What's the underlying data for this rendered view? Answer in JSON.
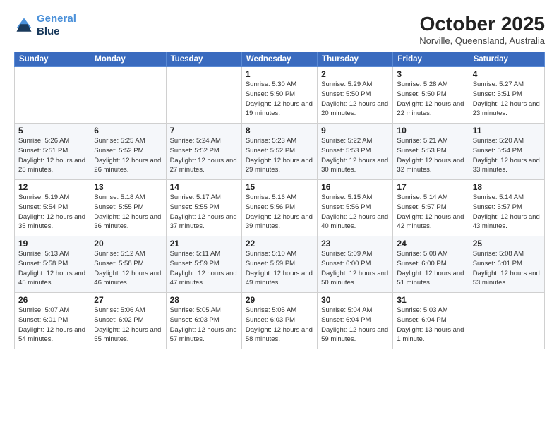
{
  "header": {
    "logo_line1": "General",
    "logo_line2": "Blue",
    "month": "October 2025",
    "location": "Norville, Queensland, Australia"
  },
  "weekdays": [
    "Sunday",
    "Monday",
    "Tuesday",
    "Wednesday",
    "Thursday",
    "Friday",
    "Saturday"
  ],
  "weeks": [
    [
      {
        "day": "",
        "info": ""
      },
      {
        "day": "",
        "info": ""
      },
      {
        "day": "",
        "info": ""
      },
      {
        "day": "1",
        "info": "Sunrise: 5:30 AM\nSunset: 5:50 PM\nDaylight: 12 hours\nand 19 minutes."
      },
      {
        "day": "2",
        "info": "Sunrise: 5:29 AM\nSunset: 5:50 PM\nDaylight: 12 hours\nand 20 minutes."
      },
      {
        "day": "3",
        "info": "Sunrise: 5:28 AM\nSunset: 5:50 PM\nDaylight: 12 hours\nand 22 minutes."
      },
      {
        "day": "4",
        "info": "Sunrise: 5:27 AM\nSunset: 5:51 PM\nDaylight: 12 hours\nand 23 minutes."
      }
    ],
    [
      {
        "day": "5",
        "info": "Sunrise: 5:26 AM\nSunset: 5:51 PM\nDaylight: 12 hours\nand 25 minutes."
      },
      {
        "day": "6",
        "info": "Sunrise: 5:25 AM\nSunset: 5:52 PM\nDaylight: 12 hours\nand 26 minutes."
      },
      {
        "day": "7",
        "info": "Sunrise: 5:24 AM\nSunset: 5:52 PM\nDaylight: 12 hours\nand 27 minutes."
      },
      {
        "day": "8",
        "info": "Sunrise: 5:23 AM\nSunset: 5:52 PM\nDaylight: 12 hours\nand 29 minutes."
      },
      {
        "day": "9",
        "info": "Sunrise: 5:22 AM\nSunset: 5:53 PM\nDaylight: 12 hours\nand 30 minutes."
      },
      {
        "day": "10",
        "info": "Sunrise: 5:21 AM\nSunset: 5:53 PM\nDaylight: 12 hours\nand 32 minutes."
      },
      {
        "day": "11",
        "info": "Sunrise: 5:20 AM\nSunset: 5:54 PM\nDaylight: 12 hours\nand 33 minutes."
      }
    ],
    [
      {
        "day": "12",
        "info": "Sunrise: 5:19 AM\nSunset: 5:54 PM\nDaylight: 12 hours\nand 35 minutes."
      },
      {
        "day": "13",
        "info": "Sunrise: 5:18 AM\nSunset: 5:55 PM\nDaylight: 12 hours\nand 36 minutes."
      },
      {
        "day": "14",
        "info": "Sunrise: 5:17 AM\nSunset: 5:55 PM\nDaylight: 12 hours\nand 37 minutes."
      },
      {
        "day": "15",
        "info": "Sunrise: 5:16 AM\nSunset: 5:56 PM\nDaylight: 12 hours\nand 39 minutes."
      },
      {
        "day": "16",
        "info": "Sunrise: 5:15 AM\nSunset: 5:56 PM\nDaylight: 12 hours\nand 40 minutes."
      },
      {
        "day": "17",
        "info": "Sunrise: 5:14 AM\nSunset: 5:57 PM\nDaylight: 12 hours\nand 42 minutes."
      },
      {
        "day": "18",
        "info": "Sunrise: 5:14 AM\nSunset: 5:57 PM\nDaylight: 12 hours\nand 43 minutes."
      }
    ],
    [
      {
        "day": "19",
        "info": "Sunrise: 5:13 AM\nSunset: 5:58 PM\nDaylight: 12 hours\nand 45 minutes."
      },
      {
        "day": "20",
        "info": "Sunrise: 5:12 AM\nSunset: 5:58 PM\nDaylight: 12 hours\nand 46 minutes."
      },
      {
        "day": "21",
        "info": "Sunrise: 5:11 AM\nSunset: 5:59 PM\nDaylight: 12 hours\nand 47 minutes."
      },
      {
        "day": "22",
        "info": "Sunrise: 5:10 AM\nSunset: 5:59 PM\nDaylight: 12 hours\nand 49 minutes."
      },
      {
        "day": "23",
        "info": "Sunrise: 5:09 AM\nSunset: 6:00 PM\nDaylight: 12 hours\nand 50 minutes."
      },
      {
        "day": "24",
        "info": "Sunrise: 5:08 AM\nSunset: 6:00 PM\nDaylight: 12 hours\nand 51 minutes."
      },
      {
        "day": "25",
        "info": "Sunrise: 5:08 AM\nSunset: 6:01 PM\nDaylight: 12 hours\nand 53 minutes."
      }
    ],
    [
      {
        "day": "26",
        "info": "Sunrise: 5:07 AM\nSunset: 6:01 PM\nDaylight: 12 hours\nand 54 minutes."
      },
      {
        "day": "27",
        "info": "Sunrise: 5:06 AM\nSunset: 6:02 PM\nDaylight: 12 hours\nand 55 minutes."
      },
      {
        "day": "28",
        "info": "Sunrise: 5:05 AM\nSunset: 6:03 PM\nDaylight: 12 hours\nand 57 minutes."
      },
      {
        "day": "29",
        "info": "Sunrise: 5:05 AM\nSunset: 6:03 PM\nDaylight: 12 hours\nand 58 minutes."
      },
      {
        "day": "30",
        "info": "Sunrise: 5:04 AM\nSunset: 6:04 PM\nDaylight: 12 hours\nand 59 minutes."
      },
      {
        "day": "31",
        "info": "Sunrise: 5:03 AM\nSunset: 6:04 PM\nDaylight: 13 hours\nand 1 minute."
      },
      {
        "day": "",
        "info": ""
      }
    ]
  ]
}
